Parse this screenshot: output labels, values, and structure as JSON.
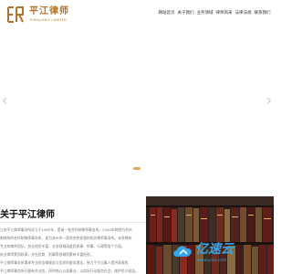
{
  "header": {
    "logo_text": "平江律师",
    "logo_sub": "PINGJIANG LAWYER",
    "nav": [
      "网站首页",
      "关于我们",
      "业务领域",
      "律师风采",
      "法律法规",
      "联系我们"
    ]
  },
  "banner": {
    "prev_arrow": "‹",
    "next_arrow": "›"
  },
  "about": {
    "title": "关于平江律师",
    "paragraphs": [
      "江苏平江律师事务所成立于1985年，是省一批合作制律师事务所。2000年转制为合伙",
      "制律所的合伙制律师事务所，现为苏州市一家综合性较强的知名律师事务所。本所拥有",
      "专业的律师团队，执业经验丰富，业务领域涵盖民商事、刑事、行政等各个方面，",
      "执业律师素质较高，并在民商、刑事等领域积累有丰富经验。",
      "平江律师事务所秉承专业的法律服务与优质的服务理念，致力于为当事人提供高效的",
      "平江律师事务所开展有关业务，同时热心公益事业，以实际行动服务社会，维护民众权益。"
    ]
  },
  "watermark": {
    "text": "亿速云",
    "sub": "www.yisu.com"
  },
  "colors": {
    "brand": "#b0742c",
    "indicator": "#e8a35d",
    "watermark": "#35a6e8"
  }
}
